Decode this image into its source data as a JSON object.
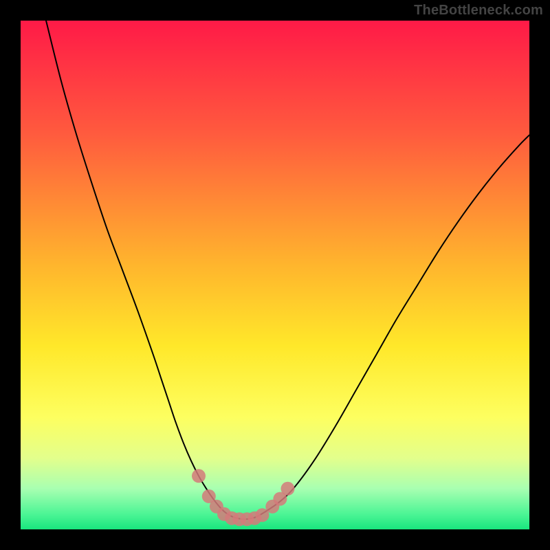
{
  "watermark": "TheBottleneck.com",
  "chart_data": {
    "type": "line",
    "title": "",
    "xlabel": "",
    "ylabel": "",
    "xlim": [
      0,
      1
    ],
    "ylim": [
      0,
      1
    ],
    "legend": false,
    "grid": false,
    "background_gradient": [
      {
        "offset": 0.0,
        "color": "#ff1a47"
      },
      {
        "offset": 0.22,
        "color": "#ff5a3e"
      },
      {
        "offset": 0.48,
        "color": "#ffb52d"
      },
      {
        "offset": 0.64,
        "color": "#ffe82a"
      },
      {
        "offset": 0.78,
        "color": "#fdff60"
      },
      {
        "offset": 0.86,
        "color": "#e3ff8c"
      },
      {
        "offset": 0.92,
        "color": "#a8ffb1"
      },
      {
        "offset": 0.97,
        "color": "#4cf595"
      },
      {
        "offset": 1.0,
        "color": "#19e57e"
      }
    ],
    "series": [
      {
        "name": "bottleneck-curve",
        "color": "#000000",
        "x": [
          0.05,
          0.08,
          0.11,
          0.14,
          0.17,
          0.2,
          0.23,
          0.26,
          0.275,
          0.29,
          0.305,
          0.32,
          0.335,
          0.35,
          0.365,
          0.38,
          0.395,
          0.41,
          0.425,
          0.44,
          0.455,
          0.47,
          0.51,
          0.54,
          0.58,
          0.62,
          0.66,
          0.7,
          0.74,
          0.78,
          0.82,
          0.86,
          0.9,
          0.94,
          0.98,
          1.0
        ],
        "y": [
          1.0,
          0.88,
          0.775,
          0.68,
          0.59,
          0.51,
          0.43,
          0.345,
          0.3,
          0.255,
          0.21,
          0.17,
          0.135,
          0.105,
          0.08,
          0.058,
          0.04,
          0.028,
          0.022,
          0.02,
          0.022,
          0.028,
          0.055,
          0.085,
          0.14,
          0.205,
          0.275,
          0.345,
          0.415,
          0.48,
          0.545,
          0.605,
          0.66,
          0.71,
          0.755,
          0.775
        ]
      }
    ],
    "markers": {
      "name": "highlight-dots",
      "color": "#d47a7a",
      "size": 10,
      "points": [
        {
          "x": 0.35,
          "y": 0.105
        },
        {
          "x": 0.37,
          "y": 0.065
        },
        {
          "x": 0.385,
          "y": 0.045
        },
        {
          "x": 0.4,
          "y": 0.03
        },
        {
          "x": 0.415,
          "y": 0.022
        },
        {
          "x": 0.43,
          "y": 0.02
        },
        {
          "x": 0.445,
          "y": 0.02
        },
        {
          "x": 0.46,
          "y": 0.022
        },
        {
          "x": 0.475,
          "y": 0.028
        },
        {
          "x": 0.495,
          "y": 0.045
        },
        {
          "x": 0.51,
          "y": 0.06
        },
        {
          "x": 0.525,
          "y": 0.08
        }
      ]
    }
  }
}
